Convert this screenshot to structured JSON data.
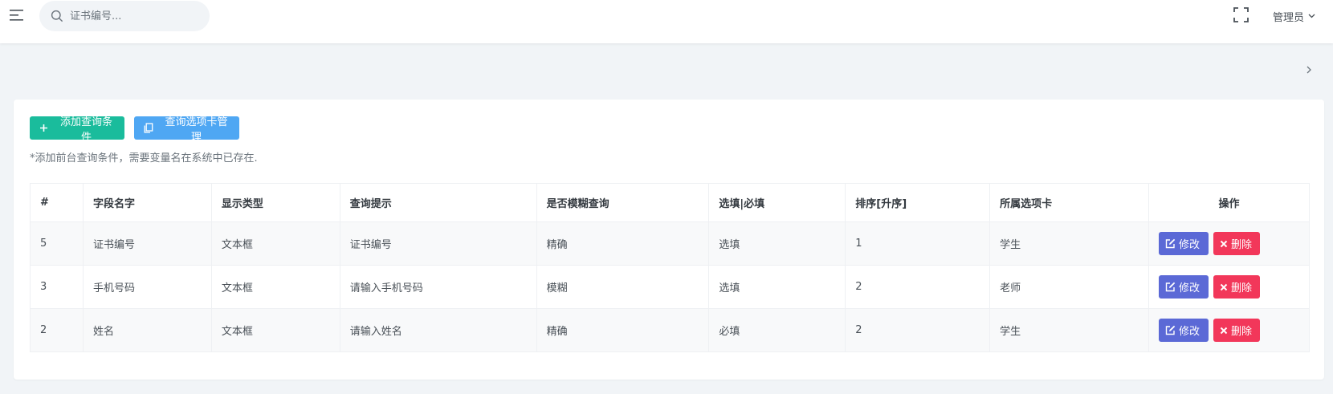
{
  "header": {
    "search_placeholder": "证书编号...",
    "user_label": "管理员"
  },
  "toolbar": {
    "add_label": "添加查询条件",
    "tab_manage_label": "查询选项卡管理",
    "hint": "*添加前台查询条件，需要变量名在系统中已存在."
  },
  "table": {
    "headers": [
      "#",
      "字段名字",
      "显示类型",
      "查询提示",
      "是否模糊查询",
      "选填|必填",
      "排序[升序]",
      "所属选项卡",
      "操作"
    ],
    "rows": [
      [
        "5",
        "证书编号",
        "文本框",
        "证书编号",
        "精确",
        "选填",
        "1",
        "学生"
      ],
      [
        "3",
        "手机号码",
        "文本框",
        "请输入手机号码",
        "模糊",
        "选填",
        "2",
        "老师"
      ],
      [
        "2",
        "姓名",
        "文本框",
        "请输入姓名",
        "精确",
        "必填",
        "2",
        "学生"
      ]
    ],
    "edit_label": "修改",
    "delete_label": "删除"
  },
  "colors": {
    "add_button": "#1abc9c",
    "tab_button": "#4fa7f3",
    "edit_button": "#5b69d6",
    "delete_button": "#f2375a"
  },
  "icons": {
    "menu": "menu-icon",
    "search": "search-icon",
    "fullscreen": "fullscreen-icon",
    "caret": "chevron-down-icon",
    "breadcrumb": "chevron-right-icon",
    "add": "plus-icon",
    "tab": "copy-icon",
    "edit": "edit-icon",
    "delete": "close-icon"
  }
}
